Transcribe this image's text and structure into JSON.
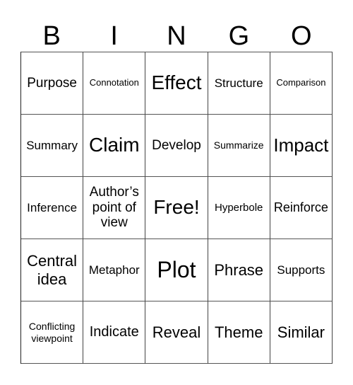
{
  "header": {
    "letters": [
      "B",
      "I",
      "N",
      "G",
      "O"
    ]
  },
  "cells": [
    [
      "Purpose",
      "Connotation",
      "Effect",
      "Structure",
      "Comparison"
    ],
    [
      "Summary",
      "Claim",
      "Develop",
      "Summarize",
      "Impact"
    ],
    [
      "Inference",
      "Author’s point of view",
      "Free!",
      "Hyperbole",
      "Reinforce"
    ],
    [
      "Central idea",
      "Metaphor",
      "Plot",
      "Phrase",
      "Supports"
    ],
    [
      "Conflicting viewpoint",
      "Indicate",
      "Reveal",
      "Theme",
      "Similar"
    ]
  ]
}
